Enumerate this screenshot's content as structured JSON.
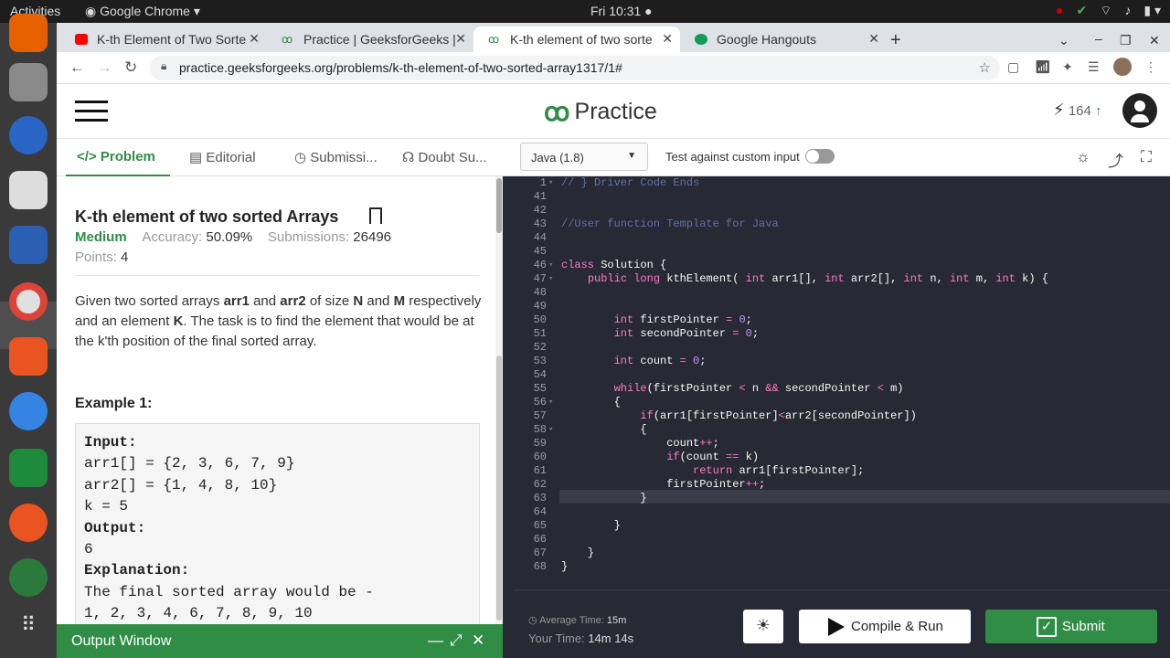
{
  "os": {
    "activities": "Activities",
    "app_name": "Google Chrome",
    "clock": "Fri 10:31"
  },
  "browser": {
    "tabs": [
      {
        "label": "K-th Element of Two Sorte",
        "favicon": "youtube-icon"
      },
      {
        "label": "Practice | GeeksforGeeks |",
        "favicon": "gfg-icon"
      },
      {
        "label": "K-th element of two sorte",
        "favicon": "gfg-icon"
      },
      {
        "label": "Google Hangouts",
        "favicon": "hangouts-icon"
      }
    ],
    "url": "practice.geeksforgeeks.org/problems/k-th-element-of-two-sorted-array1317/1#"
  },
  "header": {
    "logo_text": "Practice",
    "streak_count": "164"
  },
  "left_tabs": [
    "Problem",
    "Editorial",
    "Submissi...",
    "Doubt Su..."
  ],
  "problem": {
    "title": "K-th element of two sorted Arrays",
    "difficulty": "Medium",
    "accuracy_label": "Accuracy:",
    "accuracy": "50.09%",
    "submissions_label": "Submissions:",
    "submissions": "26496",
    "points_label": "Points:",
    "points": "4",
    "description_parts": [
      "Given two sorted arrays ",
      "arr1",
      " and ",
      "arr2",
      " of size ",
      "N",
      " and ",
      "M",
      " respectively and an element ",
      "K",
      ". The task is to find the element that would be at the k'th position of the final sorted array."
    ],
    "example_title": "Example 1:",
    "example_lines": [
      {
        "text": "Input:",
        "bold": true
      },
      {
        "text": "arr1[] = {2, 3, 6, 7, 9}",
        "bold": false
      },
      {
        "text": "arr2[] = {1, 4, 8, 10}",
        "bold": false
      },
      {
        "text": "k = 5",
        "bold": false
      },
      {
        "text": "Output:",
        "bold": true
      },
      {
        "text": "6",
        "bold": false
      },
      {
        "text": "Explanation:",
        "bold": true
      },
      {
        "text": "The final sorted array would be -",
        "bold": false
      },
      {
        "text": "1, 2, 3, 4, 6, 7, 8, 9, 10",
        "bold": false
      }
    ]
  },
  "output_window": {
    "title": "Output Window"
  },
  "editor_toolbar": {
    "language": "Java (1.8)",
    "custom_input_label": "Test against custom input"
  },
  "code": [
    {
      "n": "1",
      "fold": true,
      "html": "<span class=\"cm\">// } Driver Code Ends</span>"
    },
    {
      "n": "41",
      "html": ""
    },
    {
      "n": "42",
      "html": ""
    },
    {
      "n": "43",
      "html": "<span class=\"cm\">//User function Template for Java</span>"
    },
    {
      "n": "44",
      "html": ""
    },
    {
      "n": "45",
      "html": ""
    },
    {
      "n": "46",
      "fold": true,
      "html": "<span class=\"kw\">class</span> Solution {"
    },
    {
      "n": "47",
      "fold": true,
      "html": "    <span class=\"kw\">public</span> <span class=\"ty\">long</span> kthElement( <span class=\"ty\">int</span> arr1[], <span class=\"ty\">int</span> arr2[], <span class=\"ty\">int</span> n, <span class=\"ty\">int</span> m, <span class=\"ty\">int</span> k) {"
    },
    {
      "n": "48",
      "html": ""
    },
    {
      "n": "49",
      "html": ""
    },
    {
      "n": "50",
      "html": "        <span class=\"ty\">int</span> firstPointer <span class=\"op\">=</span> <span class=\"nu\">0</span>;"
    },
    {
      "n": "51",
      "html": "        <span class=\"ty\">int</span> secondPointer <span class=\"op\">=</span> <span class=\"nu\">0</span>;"
    },
    {
      "n": "52",
      "html": ""
    },
    {
      "n": "53",
      "html": "        <span class=\"ty\">int</span> count <span class=\"op\">=</span> <span class=\"nu\">0</span>;"
    },
    {
      "n": "54",
      "html": ""
    },
    {
      "n": "55",
      "html": "        <span class=\"kw\">while</span>(firstPointer <span class=\"op\">&lt;</span> n <span class=\"op\">&amp;&amp;</span> secondPointer <span class=\"op\">&lt;</span> m)"
    },
    {
      "n": "56",
      "fold": true,
      "html": "        {"
    },
    {
      "n": "57",
      "html": "            <span class=\"kw\">if</span>(arr1[firstPointer]<span class=\"op\">&lt;</span>arr2[secondPointer])"
    },
    {
      "n": "58",
      "fold": true,
      "html": "            {"
    },
    {
      "n": "59",
      "html": "                count<span class=\"op\">++</span>;"
    },
    {
      "n": "60",
      "html": "                <span class=\"kw\">if</span>(count <span class=\"op\">==</span> k)"
    },
    {
      "n": "61",
      "html": "                    <span class=\"kw\">return</span> arr1[firstPointer];"
    },
    {
      "n": "62",
      "html": "                firstPointer<span class=\"op\">++</span>;"
    },
    {
      "n": "63",
      "html": "            }"
    },
    {
      "n": "64",
      "html": ""
    },
    {
      "n": "65",
      "html": "        }"
    },
    {
      "n": "66",
      "html": ""
    },
    {
      "n": "67",
      "html": "    }"
    },
    {
      "n": "68",
      "html": "}"
    }
  ],
  "footer": {
    "avg_time_label": "Average Time:",
    "avg_time": "15m",
    "your_time_label": "Your Time:",
    "your_time": "14m 14s",
    "run_label": "Compile & Run",
    "submit_label": "Submit"
  },
  "colors": {
    "brand_green": "#2f8d46",
    "editor_bg": "#272935"
  }
}
